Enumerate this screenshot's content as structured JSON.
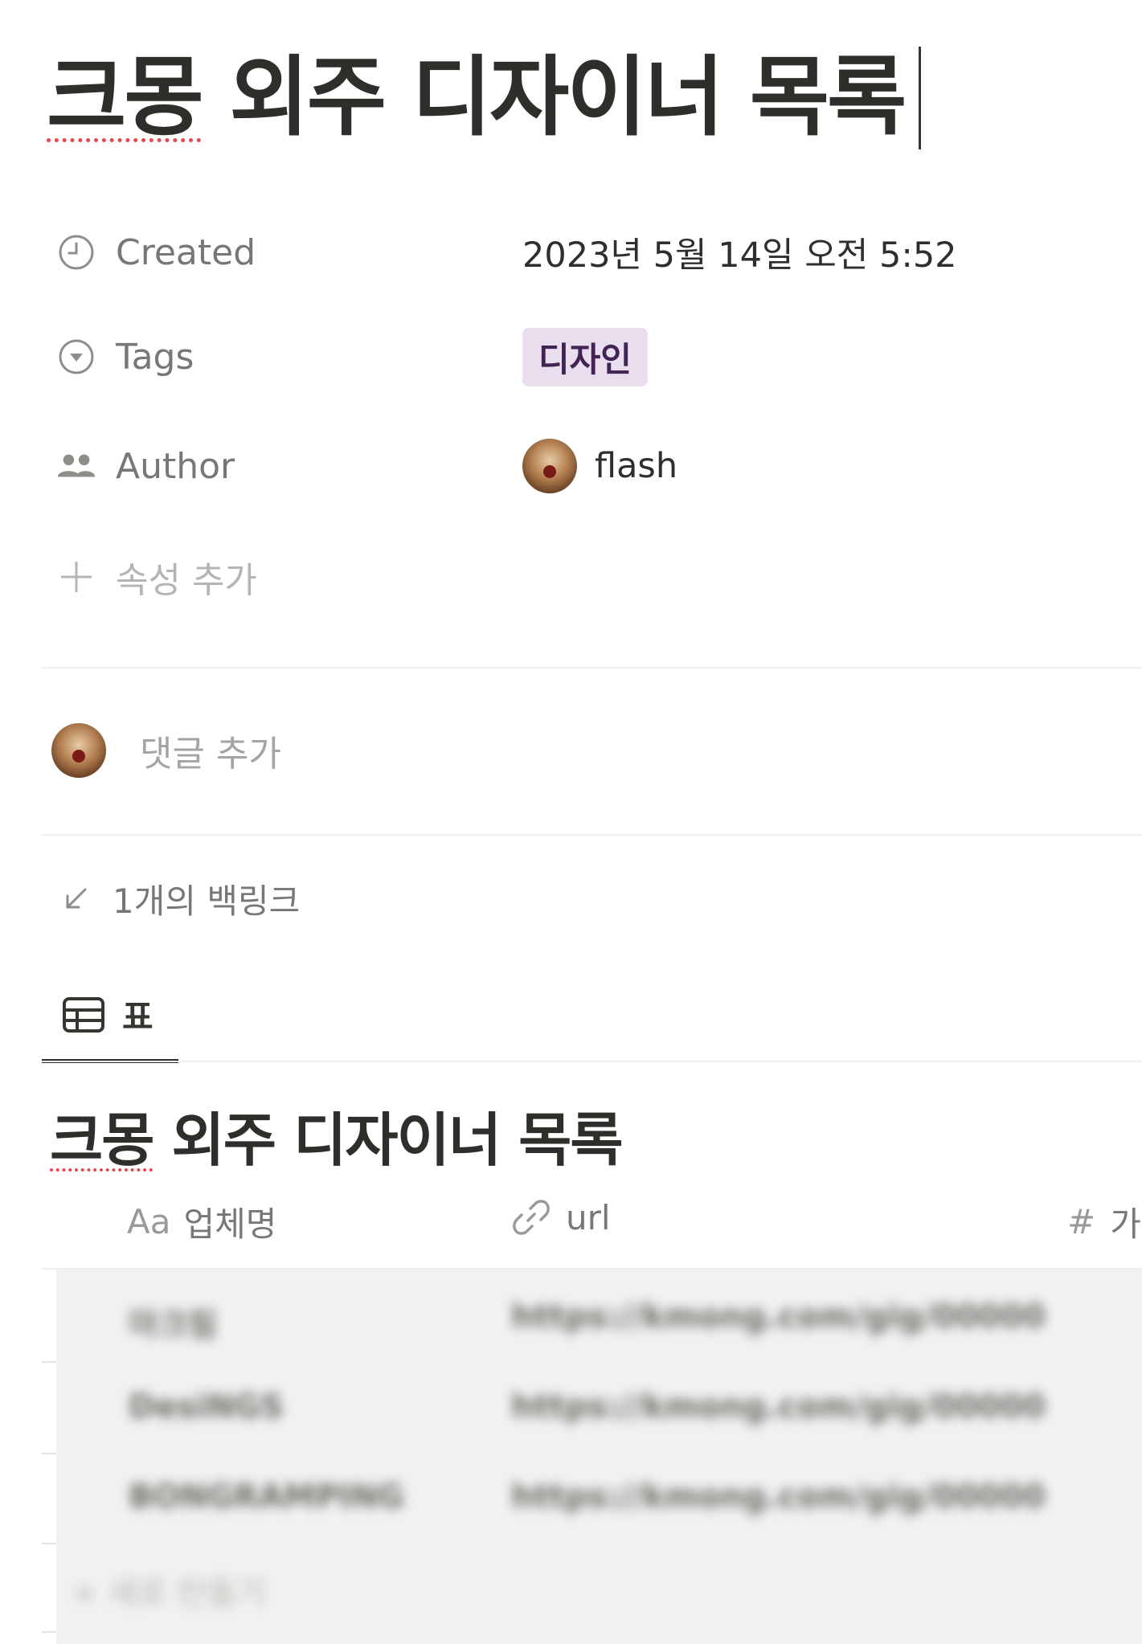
{
  "page": {
    "title_part1": "크몽",
    "title_part2": " 외주 디자이너 목록"
  },
  "properties": [
    {
      "name": "Created",
      "icon": "clock-icon",
      "value": "2023년 5월 14일 오전 5:52"
    },
    {
      "name": "Tags",
      "icon": "select-icon",
      "value": "디자인",
      "value_color": "#e8deee"
    },
    {
      "name": "Author",
      "icon": "people-icon",
      "value": "flash"
    }
  ],
  "add_property_label": "속성 추가",
  "comment": {
    "placeholder": "댓글 추가"
  },
  "backlinks_label": "1개의 백링크",
  "view_tab": {
    "label": "표",
    "icon": "table-icon"
  },
  "database": {
    "title_part1": "크몽",
    "title_part2": " 외주 디자이너 목록",
    "columns": [
      {
        "icon_text": "Aa",
        "label": "업체명"
      },
      {
        "icon": "link-icon",
        "label": "url"
      },
      {
        "icon_text": "#",
        "label": "가"
      }
    ],
    "rows": [
      {
        "name": "마크림",
        "url": "https://kmong.com/gig/00000"
      },
      {
        "name": "DesiNGS",
        "url": "https://kmong.com/gig/00000"
      },
      {
        "name": "BONGRAMPING",
        "url": "https://kmong.com/gig/00000"
      }
    ],
    "new_row_label": "+ 새로 만들기"
  },
  "colors": {
    "accent_text": "#37352f",
    "muted_text": "#787774",
    "tag_bg": "#e8deee",
    "spellcheck": "#e5484d"
  }
}
